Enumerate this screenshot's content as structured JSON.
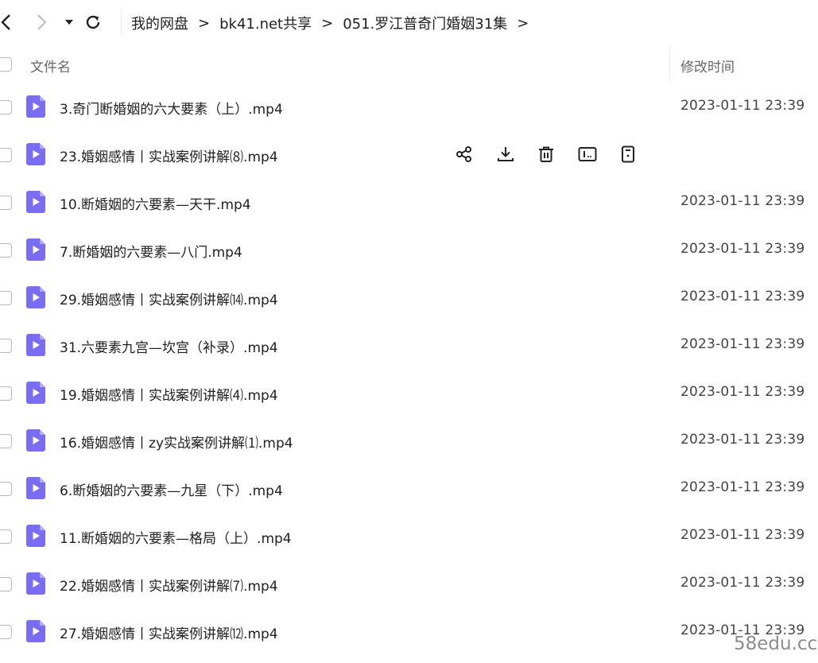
{
  "nav": {
    "back_icon": "chevron-left-icon",
    "forward_icon": "chevron-right-icon",
    "history_icon": "caret-down-icon",
    "refresh_icon": "refresh-icon"
  },
  "breadcrumb": {
    "items": [
      "我的网盘",
      "bk41.net共享",
      "051.罗江普奇门婚姻31集"
    ],
    "separator": ">"
  },
  "header": {
    "name": "文件名",
    "modified": "修改时间"
  },
  "accent_color": "#7b6cf6",
  "files": [
    {
      "name": "3.奇门断婚姻的六大要素（上）.mp4",
      "time": "2023-01-11 23:39"
    },
    {
      "name": "23.婚姻感情丨实战案例讲解⑻.mp4",
      "time": ""
    },
    {
      "name": "10.断婚姻的六要素—天干.mp4",
      "time": "2023-01-11 23:39"
    },
    {
      "name": "7.断婚姻的六要素—八门.mp4",
      "time": "2023-01-11 23:39"
    },
    {
      "name": "29.婚姻感情丨实战案例讲解⒁.mp4",
      "time": "2023-01-11 23:39"
    },
    {
      "name": "31.六要素九宫—坎宫（补录）.mp4",
      "time": "2023-01-11 23:39"
    },
    {
      "name": "19.婚姻感情丨实战案例讲解⑷.mp4",
      "time": "2023-01-11 23:39"
    },
    {
      "name": "16.婚姻感情丨zy实战案例讲解⑴.mp4",
      "time": "2023-01-11 23:39"
    },
    {
      "name": "6.断婚姻的六要素—九星（下）.mp4",
      "time": "2023-01-11 23:39"
    },
    {
      "name": "11.断婚姻的六要素—格局（上）.mp4",
      "time": "2023-01-11 23:39"
    },
    {
      "name": "22.婚姻感情丨实战案例讲解⑺.mp4",
      "time": "2023-01-11 23:39"
    },
    {
      "name": "27.婚姻感情丨实战案例讲解⑿.mp4",
      "time": "2023-01-11 23:39"
    }
  ],
  "hover_actions": [
    "share-icon",
    "download-icon",
    "delete-icon",
    "rename-icon",
    "more-file-icon"
  ],
  "watermark": "58edu.cc"
}
